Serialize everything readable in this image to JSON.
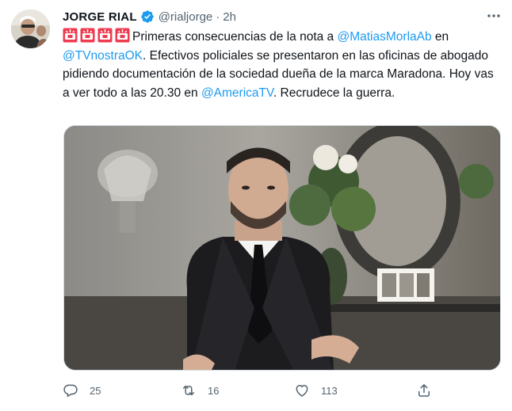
{
  "author": {
    "display_name": "JORGE RIAL",
    "handle": "@rialjorge",
    "separator": "·",
    "time": "2h",
    "verified": true
  },
  "tweet": {
    "text_1": "Primeras consecuencias de la nota a ",
    "mention_1": "@MatiasMorlaAb",
    "text_2": " en ",
    "mention_2": "@TVnostraOK",
    "text_3": ". Efectivos policiales se presentaron en las oficinas de abogado pidiendo documentación de la sociedad dueña de la marca Maradona. Hoy vas a ver todo a las 20.30 en ",
    "mention_3": "@AmericaTV",
    "text_4": ". Recrudece la guerra.",
    "emoji": [
      "police-car-light-emoji",
      "police-car-light-emoji",
      "police-car-light-emoji",
      "police-car-light-emoji"
    ]
  },
  "actions": {
    "reply_count": "25",
    "retweet_count": "16",
    "like_count": "113"
  },
  "colors": {
    "link": "#1d9bf0",
    "muted": "#536471",
    "text": "#0f1419",
    "border": "#cfd9de"
  }
}
